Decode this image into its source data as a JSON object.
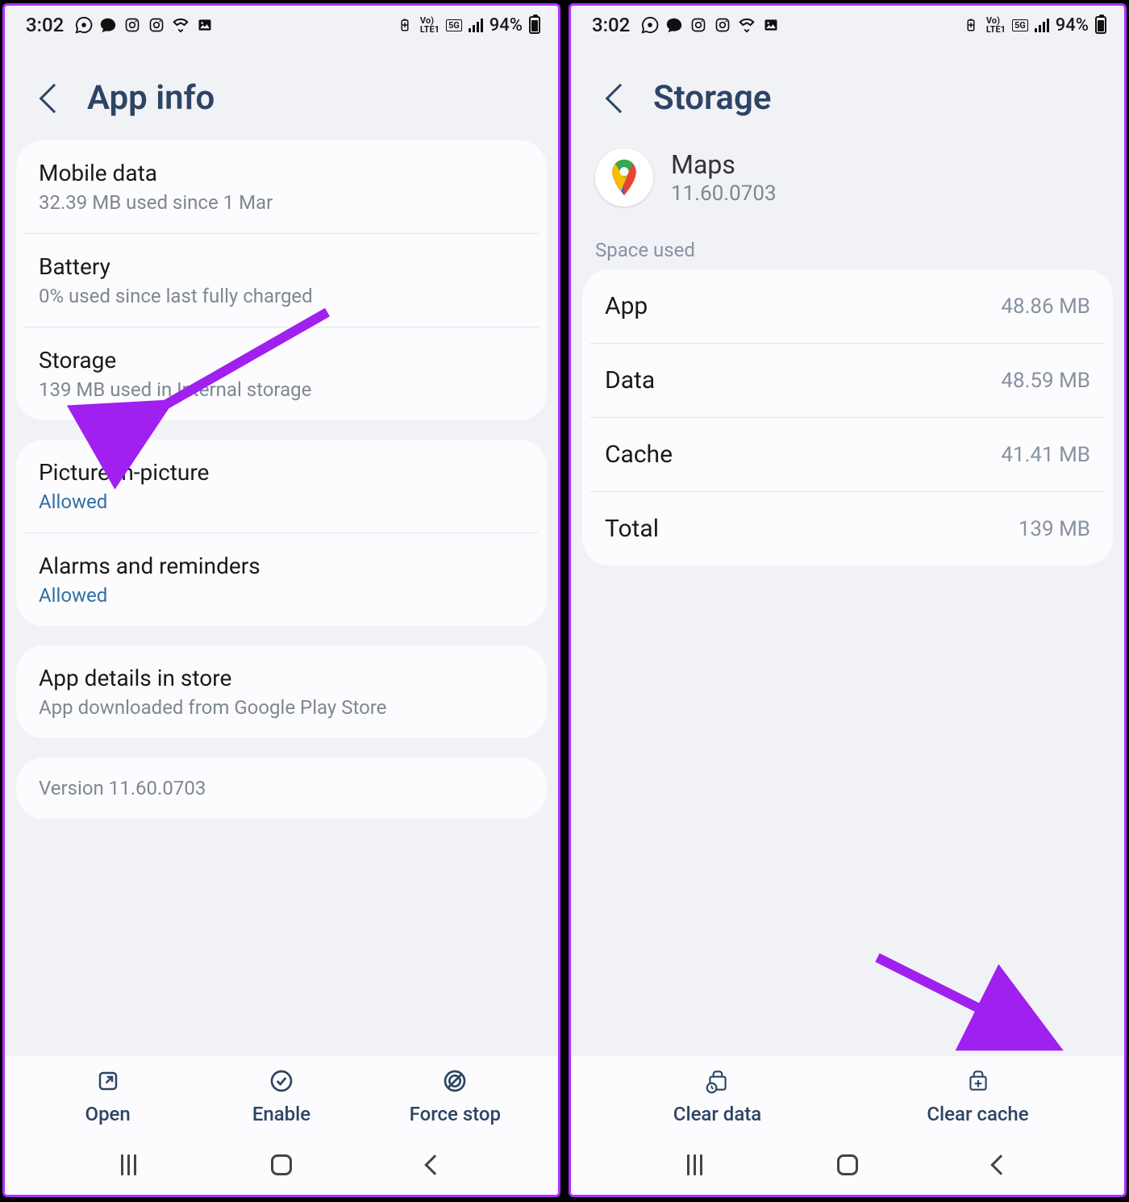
{
  "status": {
    "time": "3:02",
    "battery_pct": "94%"
  },
  "left": {
    "title": "App info",
    "rows": {
      "mobile_data": {
        "title": "Mobile data",
        "sub": "32.39 MB used since 1 Mar"
      },
      "battery": {
        "title": "Battery",
        "sub": "0% used since last fully charged"
      },
      "storage": {
        "title": "Storage",
        "sub": "139 MB used in Internal storage"
      },
      "pip": {
        "title": "Picture-in-picture",
        "sub": "Allowed"
      },
      "alarms": {
        "title": "Alarms and reminders",
        "sub": "Allowed"
      },
      "store": {
        "title": "App details in store",
        "sub": "App downloaded from Google Play Store"
      }
    },
    "version": "Version 11.60.0703",
    "actions": {
      "open": "Open",
      "enable": "Enable",
      "force_stop": "Force stop"
    }
  },
  "right": {
    "title": "Storage",
    "app": {
      "name": "Maps",
      "version": "11.60.0703"
    },
    "section_label": "Space used",
    "rows": {
      "app": {
        "k": "App",
        "v": "48.86 MB"
      },
      "data": {
        "k": "Data",
        "v": "48.59 MB"
      },
      "cache": {
        "k": "Cache",
        "v": "41.41 MB"
      },
      "total": {
        "k": "Total",
        "v": "139 MB"
      }
    },
    "actions": {
      "clear_data": "Clear data",
      "clear_cache": "Clear cache"
    }
  }
}
